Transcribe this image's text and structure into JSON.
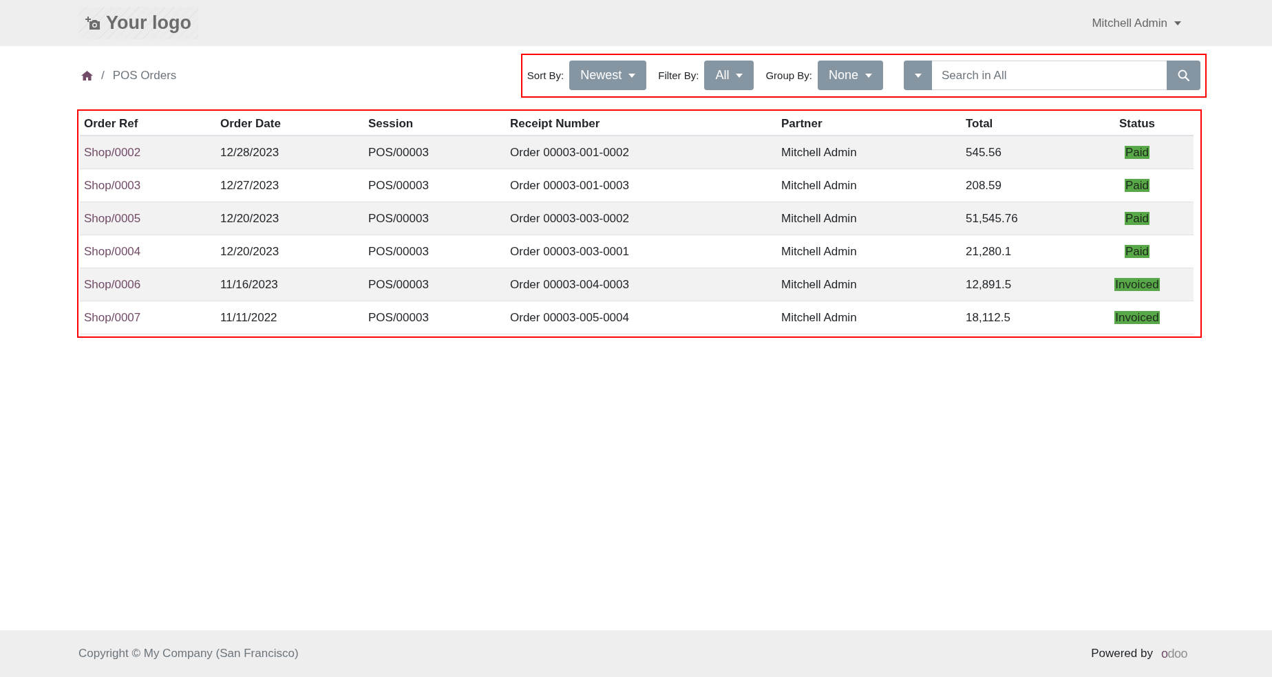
{
  "header": {
    "logo": "Your logo",
    "user": "Mitchell Admin"
  },
  "breadcrumb": {
    "separator": "/",
    "page": "POS Orders"
  },
  "toolbar": {
    "controls": [
      {
        "label": "Sort By:",
        "value": "Newest"
      },
      {
        "label": "Filter By:",
        "value": "All"
      },
      {
        "label": "Group By:",
        "value": "None"
      }
    ],
    "search": {
      "placeholder": "Search in All"
    }
  },
  "table": {
    "columns": [
      "Order Ref",
      "Order Date",
      "Session",
      "Receipt Number",
      "Partner",
      "Total",
      "Status"
    ],
    "rows": [
      {
        "order_ref": "Shop/0002",
        "order_date": "12/28/2023",
        "session": "POS/00003",
        "receipt_number": "Order 00003-001-0002",
        "partner": "Mitchell Admin",
        "total": "545.56",
        "status": "Paid"
      },
      {
        "order_ref": "Shop/0003",
        "order_date": "12/27/2023",
        "session": "POS/00003",
        "receipt_number": "Order 00003-001-0003",
        "partner": "Mitchell Admin",
        "total": "208.59",
        "status": "Paid"
      },
      {
        "order_ref": "Shop/0005",
        "order_date": "12/20/2023",
        "session": "POS/00003",
        "receipt_number": "Order 00003-003-0002",
        "partner": "Mitchell Admin",
        "total": "51,545.76",
        "status": "Paid"
      },
      {
        "order_ref": "Shop/0004",
        "order_date": "12/20/2023",
        "session": "POS/00003",
        "receipt_number": "Order 00003-003-0001",
        "partner": "Mitchell Admin",
        "total": "21,280.1",
        "status": "Paid"
      },
      {
        "order_ref": "Shop/0006",
        "order_date": "11/16/2023",
        "session": "POS/00003",
        "receipt_number": "Order 00003-004-0003",
        "partner": "Mitchell Admin",
        "total": "12,891.5",
        "status": "Invoiced"
      },
      {
        "order_ref": "Shop/0007",
        "order_date": "11/11/2022",
        "session": "POS/00003",
        "receipt_number": "Order 00003-005-0004",
        "partner": "Mitchell Admin",
        "total": "18,112.5",
        "status": "Invoiced"
      }
    ]
  },
  "footer": {
    "copyright": "Copyright © My Company (San Francisco)",
    "powered_by": "Powered by",
    "brand": "odoo"
  }
}
